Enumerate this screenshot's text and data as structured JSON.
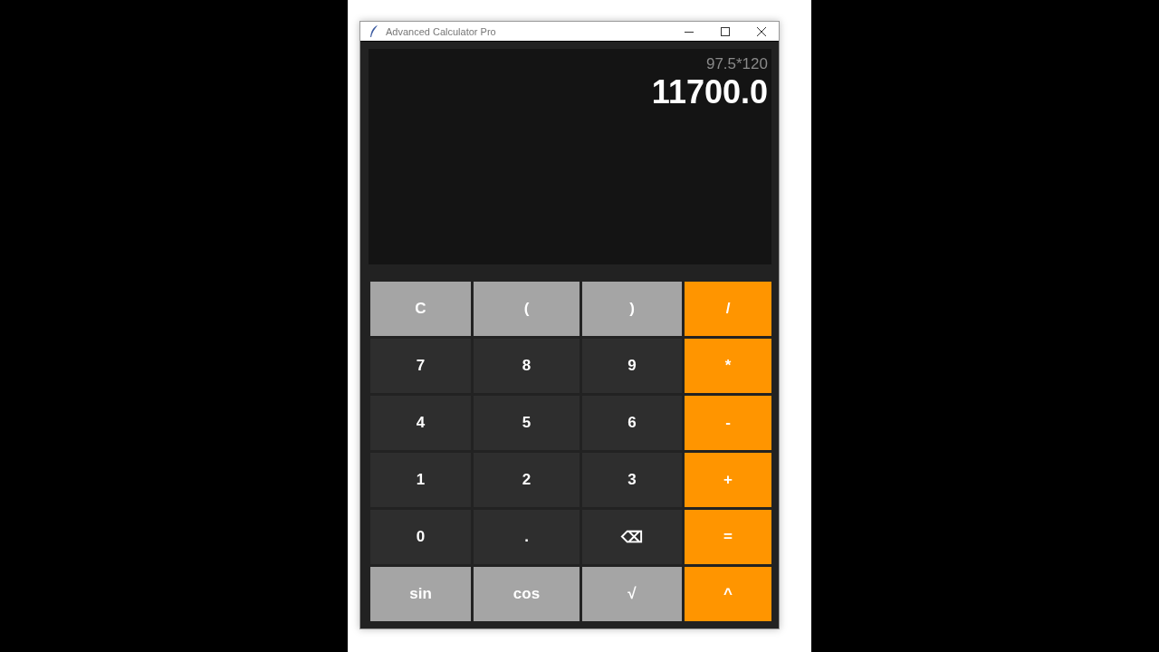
{
  "window": {
    "title": "Advanced Calculator Pro"
  },
  "display": {
    "expression": "97.5*120",
    "result": "11700.0"
  },
  "keypad": [
    {
      "label": "C",
      "kind": "function"
    },
    {
      "label": "(",
      "kind": "function"
    },
    {
      "label": ")",
      "kind": "function"
    },
    {
      "label": "/",
      "kind": "operator"
    },
    {
      "label": "7",
      "kind": "digit"
    },
    {
      "label": "8",
      "kind": "digit"
    },
    {
      "label": "9",
      "kind": "digit"
    },
    {
      "label": "*",
      "kind": "operator"
    },
    {
      "label": "4",
      "kind": "digit"
    },
    {
      "label": "5",
      "kind": "digit"
    },
    {
      "label": "6",
      "kind": "digit"
    },
    {
      "label": "-",
      "kind": "operator"
    },
    {
      "label": "1",
      "kind": "digit"
    },
    {
      "label": "2",
      "kind": "digit"
    },
    {
      "label": "3",
      "kind": "digit"
    },
    {
      "label": "+",
      "kind": "operator"
    },
    {
      "label": "0",
      "kind": "digit"
    },
    {
      "label": ".",
      "kind": "digit"
    },
    {
      "label": "⌫",
      "kind": "digit"
    },
    {
      "label": "=",
      "kind": "operator"
    },
    {
      "label": "sin",
      "kind": "function"
    },
    {
      "label": "cos",
      "kind": "function"
    },
    {
      "label": "√",
      "kind": "function"
    },
    {
      "label": "^",
      "kind": "operator"
    }
  ]
}
